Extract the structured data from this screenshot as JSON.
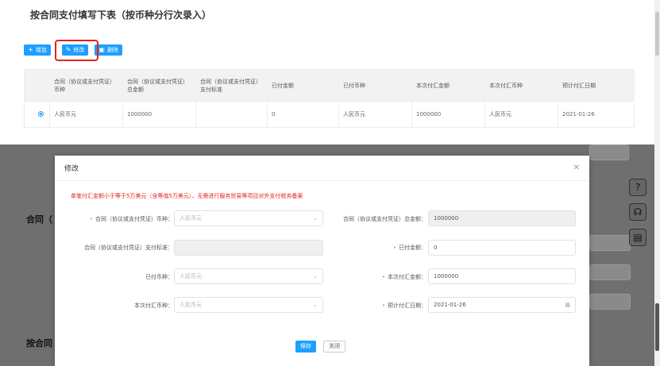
{
  "section_title": "按合同支付填写下表（按币种分行次录入）",
  "toolbar": {
    "add_label": "增加",
    "add_icon": "plus-icon",
    "edit_label": "修改",
    "edit_icon": "pencil-icon",
    "delete_label": "删除",
    "delete_icon": "trash-icon"
  },
  "table": {
    "headers": [
      "合同（协议或支付凭证）币种",
      "合同（协议或支付凭证）总金额",
      "合同（协议或支付凭证）支付标准",
      "已付金额",
      "已付币种",
      "本次付汇金额",
      "本次付汇币种",
      "预计付汇日期"
    ],
    "rows": [
      {
        "selected": true,
        "cells": [
          "人民币元",
          "1000000",
          "",
          "0",
          "人民币元",
          "1000000",
          "人民币元",
          "2021-01-26"
        ]
      }
    ]
  },
  "background": {
    "label_1": "合同（",
    "label_2": "按合同"
  },
  "modal": {
    "title": "修改",
    "close_icon": "close-icon",
    "warning": "单笔付汇金额小于等于5万美元（含等值5万美元），无需进行服务贸易等项目对外支付税务备案",
    "fields": {
      "currency": {
        "label": "合同（协议或支付凭证）币种：",
        "placeholder": "人民币元",
        "required": true
      },
      "total": {
        "label": "合同（协议或支付凭证）总金额：",
        "value": "1000000",
        "required": false
      },
      "standard": {
        "label": "合同（协议或支付凭证）支付标准：",
        "value": "",
        "required": false
      },
      "paid_amount": {
        "label": "已付金额：",
        "value": "0",
        "required": true
      },
      "paid_currency": {
        "label": "已付币种：",
        "placeholder": "人民币元",
        "required": false
      },
      "remit_amount": {
        "label": "本次付汇金额：",
        "value": "1000000",
        "required": true
      },
      "remit_currency": {
        "label": "本次付汇币种：",
        "placeholder": "人民币元",
        "required": false
      },
      "remit_date": {
        "label": "预计付汇日期：",
        "value": "2021-01-26",
        "required": true
      }
    },
    "save_label": "保存",
    "close_label": "关闭"
  },
  "colors": {
    "primary": "#1e9fff",
    "warning": "#e0241b",
    "required": "#f59a23"
  }
}
